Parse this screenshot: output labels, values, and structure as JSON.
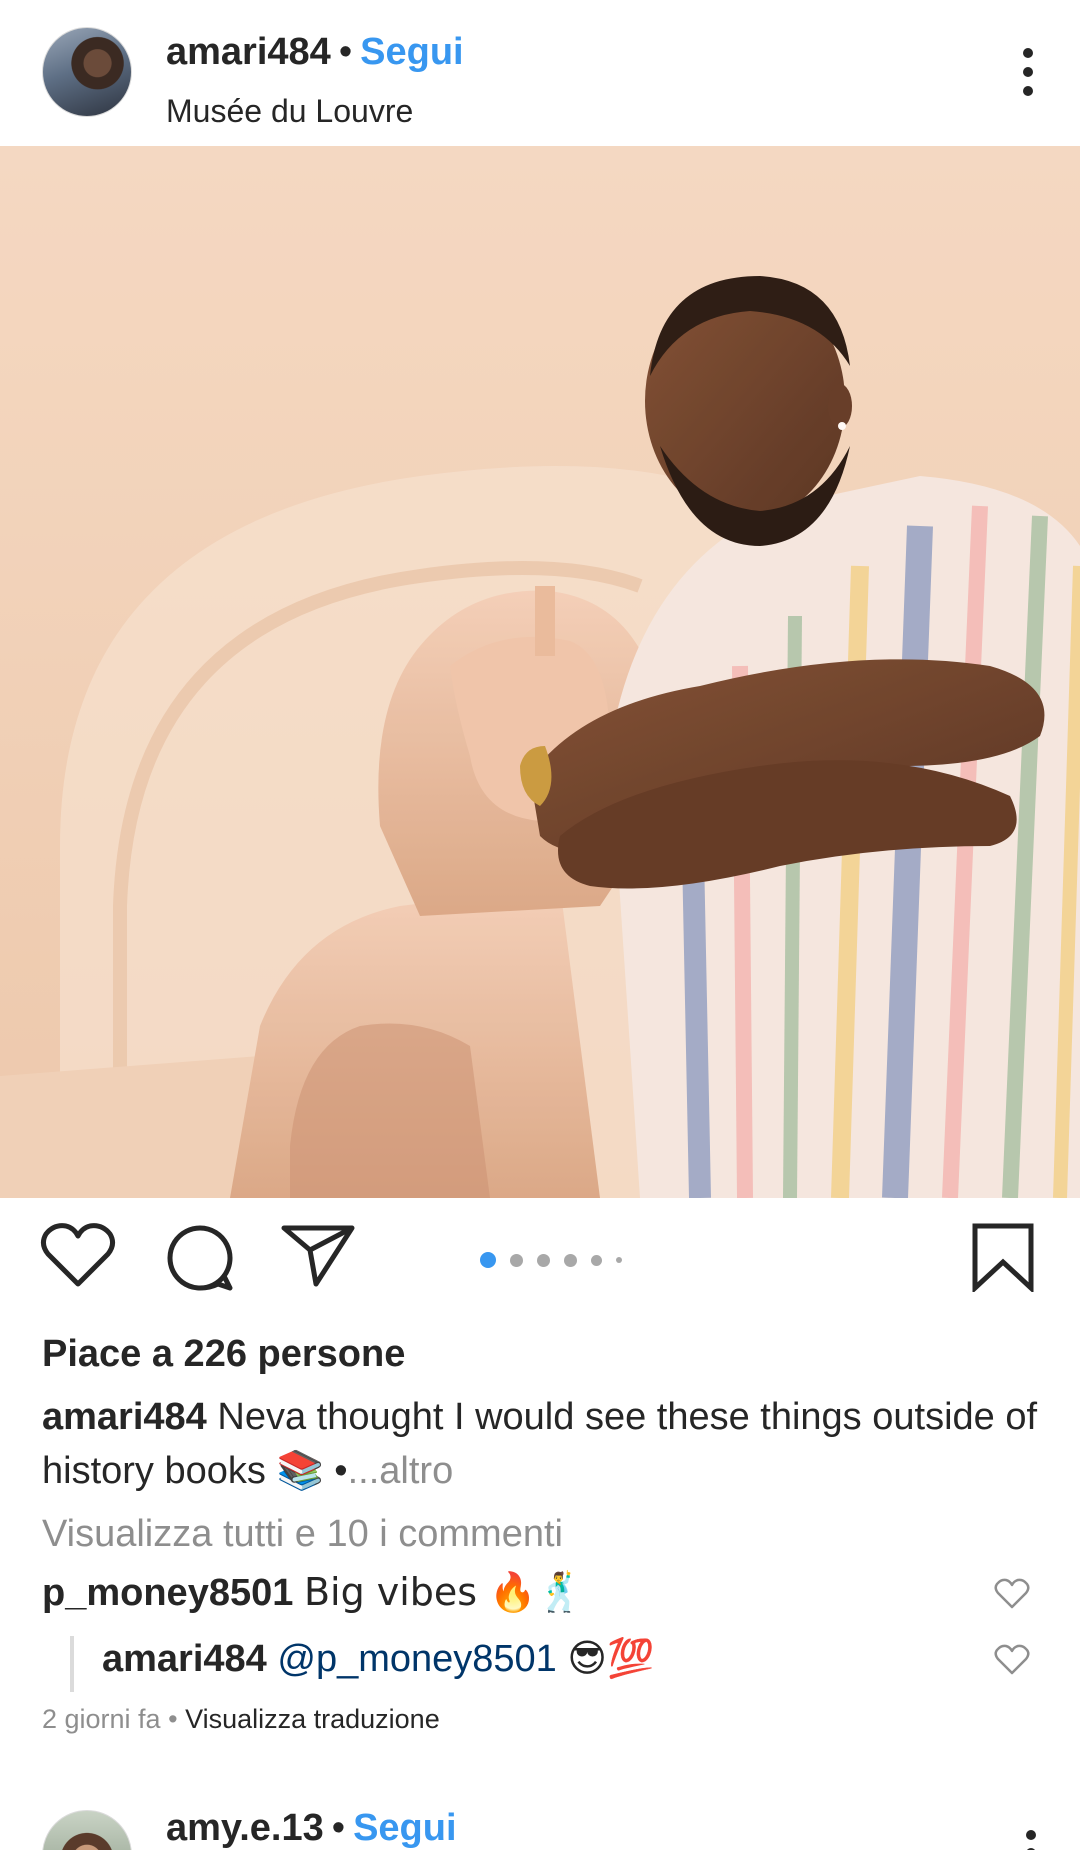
{
  "post": {
    "username": "amari484",
    "follow_label": "Segui",
    "separator": "•",
    "location": "Musée du Louvre"
  },
  "photo": {
    "description_icon": "photo-sphinx-selfie"
  },
  "carousel": {
    "count": 6,
    "active_index": 0,
    "active_color": "#3897f0",
    "inactive_color": "#a8a8a8"
  },
  "likes_text": "Piace a 226 persone",
  "caption": {
    "username": "amari484",
    "text": "Neva thought I would see these things outside of history books 📚 •",
    "more_label": "...altro"
  },
  "view_all_comments": "Visualizza tutti e 10 i commenti",
  "comments": [
    {
      "username": "p_money8501",
      "text": "Big vibes 🔥🕺"
    }
  ],
  "reply": {
    "username": "amari484",
    "mention": "@p_money8501",
    "text": "😎💯"
  },
  "meta": {
    "timestamp": "2 giorni fa",
    "separator": "•",
    "translate_label": "Visualizza traduzione"
  },
  "next_post": {
    "username": "amy.e.13",
    "separator": "•",
    "follow_label": "Segui"
  },
  "colors": {
    "link_blue": "#3897f0",
    "mention_blue": "#003569",
    "muted_gray": "#8e8e8e",
    "text_dark": "#262626"
  }
}
